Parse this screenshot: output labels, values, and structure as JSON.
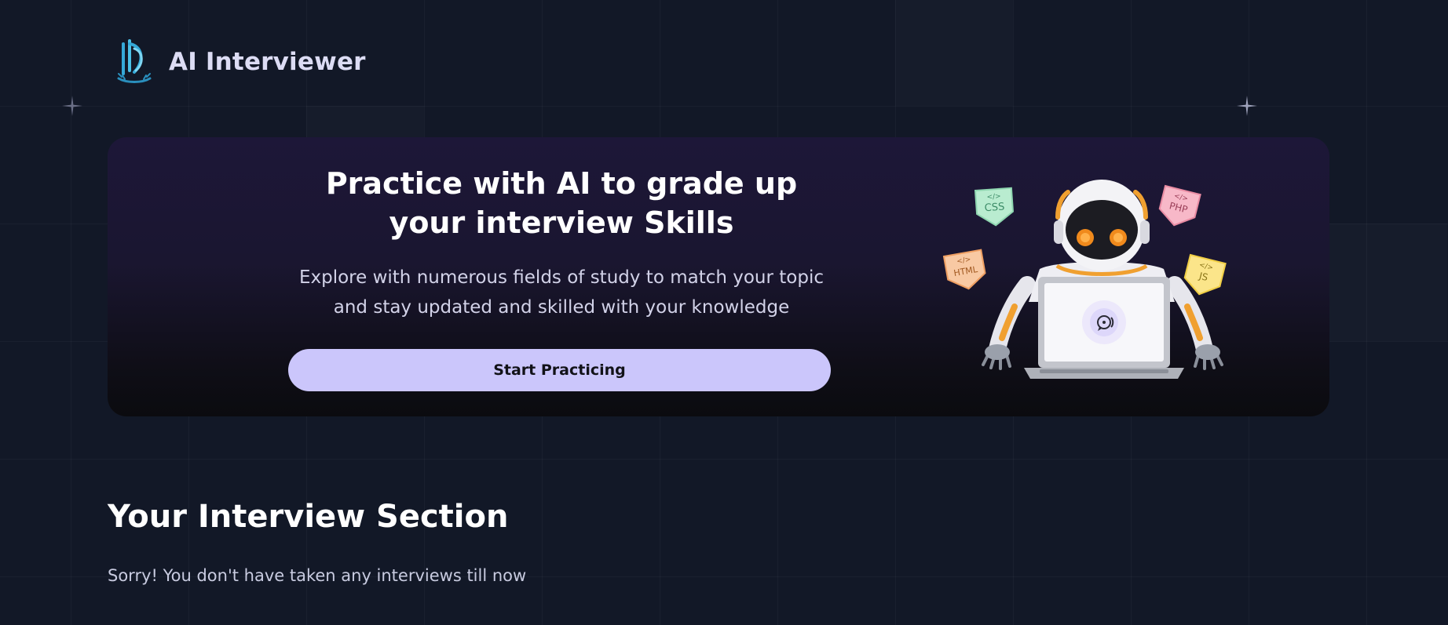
{
  "app": {
    "title": "AI Interviewer"
  },
  "hero": {
    "title": "Practice with AI to grade up your interview Skills",
    "subtitle": "Explore with numerous fields of study to match your topic and stay updated and skilled with your knowledge",
    "cta_label": "Start Practicing"
  },
  "tech_badges": {
    "css": "CSS",
    "php": "PHP",
    "html": "HTML",
    "js": "JS",
    "code_symbol": "</>"
  },
  "interviews": {
    "section_title": "Your Interview Section",
    "empty_message": "Sorry! You don't have taken any interviews till now"
  },
  "colors": {
    "page_background": "#121827",
    "hero_gradient_top": "#1d1738",
    "hero_gradient_bottom": "#0b0b0f",
    "cta_background": "#cbc6fb",
    "logo_accent": "#35a9d8",
    "text_primary": "#ffffff",
    "text_secondary": "#c8cbe0"
  },
  "icons": {
    "logo": "ld-logo-icon",
    "chat": "chat-bubble-icon",
    "sparkle": "sparkle-icon"
  }
}
